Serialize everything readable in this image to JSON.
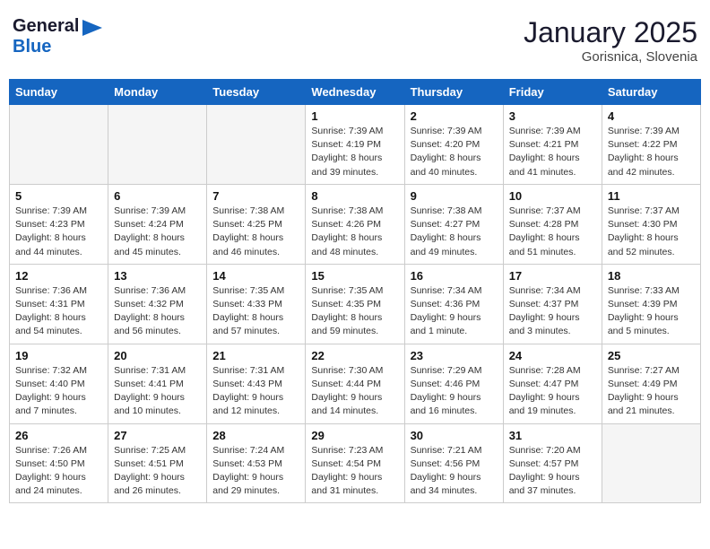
{
  "logo": {
    "general": "General",
    "blue": "Blue"
  },
  "title": "January 2025",
  "location": "Gorisnica, Slovenia",
  "days_of_week": [
    "Sunday",
    "Monday",
    "Tuesday",
    "Wednesday",
    "Thursday",
    "Friday",
    "Saturday"
  ],
  "weeks": [
    [
      {
        "day": "",
        "info": "",
        "empty": true
      },
      {
        "day": "",
        "info": "",
        "empty": true
      },
      {
        "day": "",
        "info": "",
        "empty": true
      },
      {
        "day": "1",
        "info": "Sunrise: 7:39 AM\nSunset: 4:19 PM\nDaylight: 8 hours\nand 39 minutes."
      },
      {
        "day": "2",
        "info": "Sunrise: 7:39 AM\nSunset: 4:20 PM\nDaylight: 8 hours\nand 40 minutes."
      },
      {
        "day": "3",
        "info": "Sunrise: 7:39 AM\nSunset: 4:21 PM\nDaylight: 8 hours\nand 41 minutes."
      },
      {
        "day": "4",
        "info": "Sunrise: 7:39 AM\nSunset: 4:22 PM\nDaylight: 8 hours\nand 42 minutes."
      }
    ],
    [
      {
        "day": "5",
        "info": "Sunrise: 7:39 AM\nSunset: 4:23 PM\nDaylight: 8 hours\nand 44 minutes."
      },
      {
        "day": "6",
        "info": "Sunrise: 7:39 AM\nSunset: 4:24 PM\nDaylight: 8 hours\nand 45 minutes."
      },
      {
        "day": "7",
        "info": "Sunrise: 7:38 AM\nSunset: 4:25 PM\nDaylight: 8 hours\nand 46 minutes."
      },
      {
        "day": "8",
        "info": "Sunrise: 7:38 AM\nSunset: 4:26 PM\nDaylight: 8 hours\nand 48 minutes."
      },
      {
        "day": "9",
        "info": "Sunrise: 7:38 AM\nSunset: 4:27 PM\nDaylight: 8 hours\nand 49 minutes."
      },
      {
        "day": "10",
        "info": "Sunrise: 7:37 AM\nSunset: 4:28 PM\nDaylight: 8 hours\nand 51 minutes."
      },
      {
        "day": "11",
        "info": "Sunrise: 7:37 AM\nSunset: 4:30 PM\nDaylight: 8 hours\nand 52 minutes."
      }
    ],
    [
      {
        "day": "12",
        "info": "Sunrise: 7:36 AM\nSunset: 4:31 PM\nDaylight: 8 hours\nand 54 minutes."
      },
      {
        "day": "13",
        "info": "Sunrise: 7:36 AM\nSunset: 4:32 PM\nDaylight: 8 hours\nand 56 minutes."
      },
      {
        "day": "14",
        "info": "Sunrise: 7:35 AM\nSunset: 4:33 PM\nDaylight: 8 hours\nand 57 minutes."
      },
      {
        "day": "15",
        "info": "Sunrise: 7:35 AM\nSunset: 4:35 PM\nDaylight: 8 hours\nand 59 minutes."
      },
      {
        "day": "16",
        "info": "Sunrise: 7:34 AM\nSunset: 4:36 PM\nDaylight: 9 hours\nand 1 minute."
      },
      {
        "day": "17",
        "info": "Sunrise: 7:34 AM\nSunset: 4:37 PM\nDaylight: 9 hours\nand 3 minutes."
      },
      {
        "day": "18",
        "info": "Sunrise: 7:33 AM\nSunset: 4:39 PM\nDaylight: 9 hours\nand 5 minutes."
      }
    ],
    [
      {
        "day": "19",
        "info": "Sunrise: 7:32 AM\nSunset: 4:40 PM\nDaylight: 9 hours\nand 7 minutes."
      },
      {
        "day": "20",
        "info": "Sunrise: 7:31 AM\nSunset: 4:41 PM\nDaylight: 9 hours\nand 10 minutes."
      },
      {
        "day": "21",
        "info": "Sunrise: 7:31 AM\nSunset: 4:43 PM\nDaylight: 9 hours\nand 12 minutes."
      },
      {
        "day": "22",
        "info": "Sunrise: 7:30 AM\nSunset: 4:44 PM\nDaylight: 9 hours\nand 14 minutes."
      },
      {
        "day": "23",
        "info": "Sunrise: 7:29 AM\nSunset: 4:46 PM\nDaylight: 9 hours\nand 16 minutes."
      },
      {
        "day": "24",
        "info": "Sunrise: 7:28 AM\nSunset: 4:47 PM\nDaylight: 9 hours\nand 19 minutes."
      },
      {
        "day": "25",
        "info": "Sunrise: 7:27 AM\nSunset: 4:49 PM\nDaylight: 9 hours\nand 21 minutes."
      }
    ],
    [
      {
        "day": "26",
        "info": "Sunrise: 7:26 AM\nSunset: 4:50 PM\nDaylight: 9 hours\nand 24 minutes."
      },
      {
        "day": "27",
        "info": "Sunrise: 7:25 AM\nSunset: 4:51 PM\nDaylight: 9 hours\nand 26 minutes."
      },
      {
        "day": "28",
        "info": "Sunrise: 7:24 AM\nSunset: 4:53 PM\nDaylight: 9 hours\nand 29 minutes."
      },
      {
        "day": "29",
        "info": "Sunrise: 7:23 AM\nSunset: 4:54 PM\nDaylight: 9 hours\nand 31 minutes."
      },
      {
        "day": "30",
        "info": "Sunrise: 7:21 AM\nSunset: 4:56 PM\nDaylight: 9 hours\nand 34 minutes."
      },
      {
        "day": "31",
        "info": "Sunrise: 7:20 AM\nSunset: 4:57 PM\nDaylight: 9 hours\nand 37 minutes."
      },
      {
        "day": "",
        "info": "",
        "empty": true
      }
    ]
  ]
}
